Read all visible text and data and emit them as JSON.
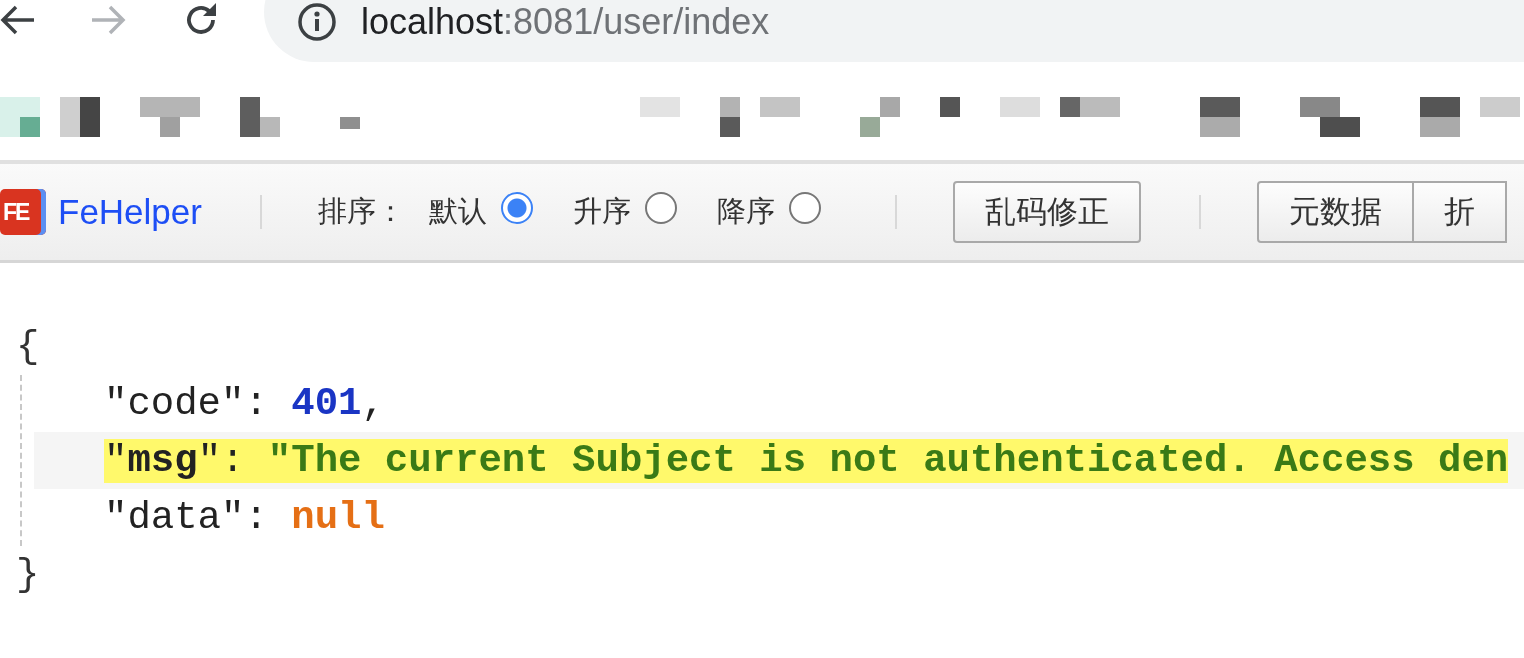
{
  "address_bar": {
    "host": "localhost",
    "rest": ":8081/user/index"
  },
  "toolbar": {
    "logo_mark": "FE",
    "logo": "FeHelper",
    "sort_label": "排序：",
    "sort_options": [
      {
        "label": "默认",
        "selected": true
      },
      {
        "label": "升序",
        "selected": false
      },
      {
        "label": "降序",
        "selected": false
      }
    ],
    "buttons": [
      "乱码修正"
    ],
    "group_buttons": [
      "元数据",
      "折"
    ]
  },
  "json_view": {
    "open": "{",
    "close": "}",
    "entries": [
      {
        "key": "\"code\"",
        "colon": ":",
        "value": "401",
        "kind": "number",
        "comma": ",",
        "highlighted": false
      },
      {
        "key": "\"**msg**\"",
        "colon": ":",
        "value": "\"The current Subject is not authenticated. Access den",
        "kind": "string",
        "highlighted": true
      },
      {
        "key": "\"data\"",
        "colon": ":",
        "value": "null",
        "kind": "null",
        "highlighted": false
      }
    ]
  }
}
